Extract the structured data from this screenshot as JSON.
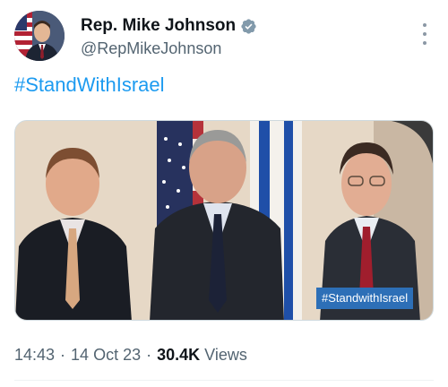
{
  "author": {
    "display_name": "Rep. Mike Johnson",
    "handle": "@RepMikeJohnson",
    "verified": true
  },
  "tweet": {
    "text": "#StandWithIsrael",
    "image_caption_tag": "#StandwithIsrael",
    "time": "14:43",
    "date": "14 Oct 23",
    "views_count": "30.4K",
    "views_label": "Views"
  },
  "icons": {
    "verified": "verified-badge-icon",
    "more": "more-options-icon"
  },
  "colors": {
    "link": "#1d9bf0",
    "secondary_text": "#536471",
    "verified_badge": "#829aab",
    "tag_background": "#2d6fb7"
  }
}
